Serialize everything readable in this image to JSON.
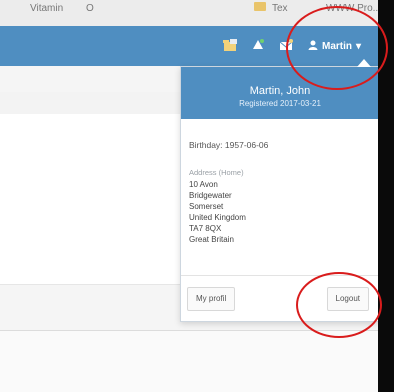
{
  "browser_tabs": [
    {
      "label": "Vitamin"
    },
    {
      "label": "O"
    },
    {
      "label": "Tex"
    },
    {
      "label": "WWW Pro..."
    }
  ],
  "topbar": {
    "icons": [
      "folders-icon",
      "bell-icon",
      "mail-icon"
    ],
    "user_label": "Martin"
  },
  "dropdown": {
    "name": "Martin, John",
    "subtitle": "Registered 2017-03-21",
    "birthday": "Birthday: 1957-06-06",
    "address_heading": "Address (Home)",
    "address_lines": [
      "10 Avon",
      "Bridgewater",
      "Somerset",
      "United Kingdom",
      "TA7 8QX",
      "Great Britain"
    ],
    "my_profile_label": "My profil",
    "logout_label": "Logout"
  },
  "colors": {
    "brand_blue": "#4f8ec1",
    "highlight_red": "#d91c1c"
  }
}
